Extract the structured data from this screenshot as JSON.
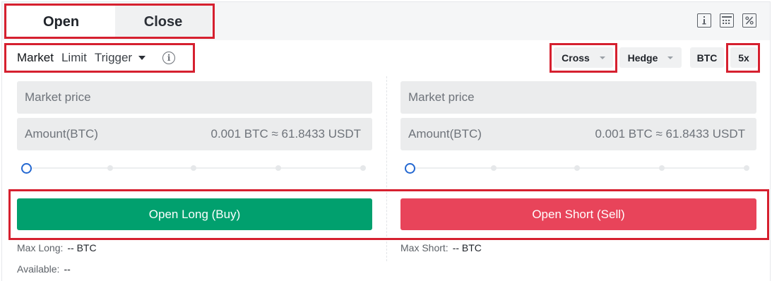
{
  "tabs": {
    "open_label": "Open",
    "close_label": "Close"
  },
  "top_icons": [
    "info-icon",
    "calculator-icon",
    "percent-icon"
  ],
  "order_types": {
    "market": "Market",
    "limit": "Limit",
    "trigger": "Trigger"
  },
  "controls": {
    "margin_mode": "Cross",
    "position_mode": "Hedge",
    "asset": "BTC",
    "leverage": "5x"
  },
  "long_panel": {
    "price_placeholder": "Market price",
    "amount_label": "Amount(BTC)",
    "amount_conversion": "0.001 BTC ≈ 61.8433 USDT",
    "slider_percent": 0,
    "button_label": "Open Long (Buy)",
    "max_label": "Max Long:",
    "max_value": "-- BTC",
    "available_label": "Available:",
    "available_value": "--"
  },
  "short_panel": {
    "price_placeholder": "Market price",
    "amount_label": "Amount(BTC)",
    "amount_conversion": "0.001 BTC ≈ 61.8433 USDT",
    "slider_percent": 0,
    "button_label": "Open Short (Sell)",
    "max_label": "Max Short:",
    "max_value": "-- BTC"
  },
  "colors": {
    "long_button": "#01a06e",
    "short_button": "#e8445a",
    "highlight_box": "#d6202f",
    "slider_knob": "#2468d1"
  }
}
